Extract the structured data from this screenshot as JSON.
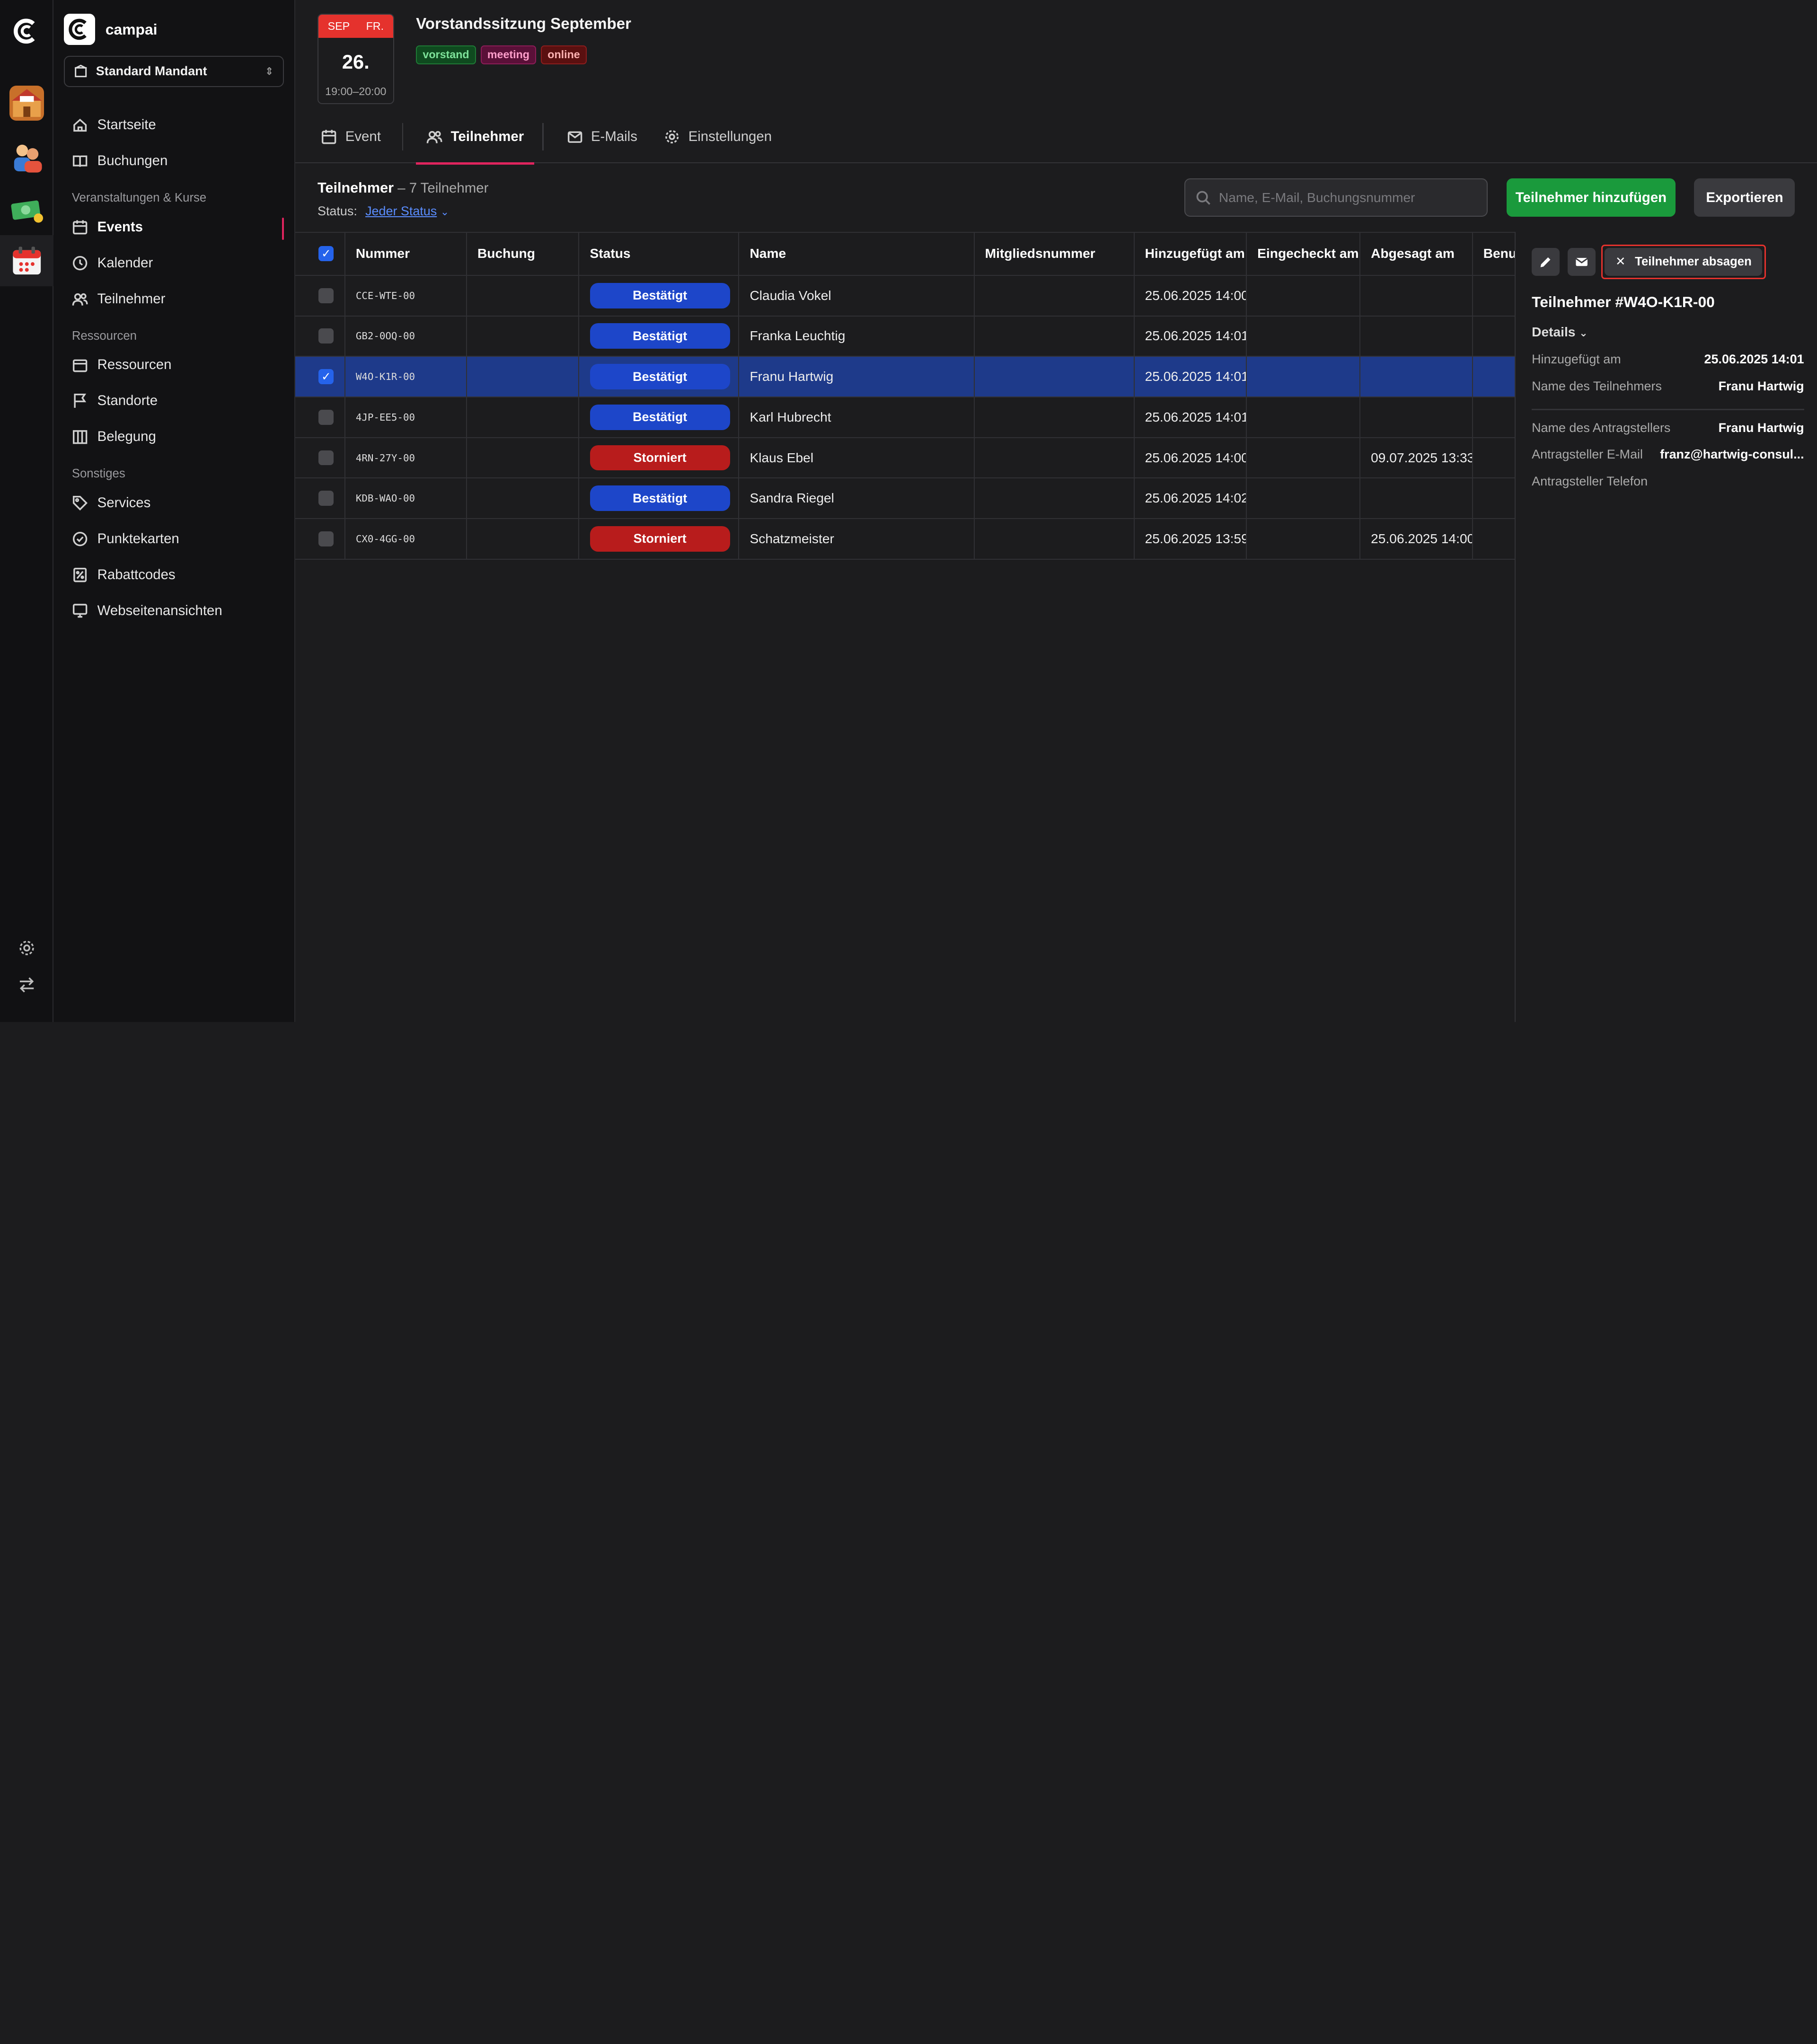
{
  "app": {
    "brand_name": "campai"
  },
  "tenant": {
    "label": "Standard Mandant"
  },
  "sidebar": {
    "items": [
      {
        "label": "Startseite",
        "icon": "home-icon"
      },
      {
        "label": "Buchungen",
        "icon": "book-icon"
      }
    ],
    "sections": [
      {
        "title": "Veranstaltungen & Kurse",
        "items": [
          {
            "label": "Events",
            "icon": "calendar-icon",
            "active": true
          },
          {
            "label": "Kalender",
            "icon": "clock-icon"
          },
          {
            "label": "Teilnehmer",
            "icon": "users-icon"
          }
        ]
      },
      {
        "title": "Ressourcen",
        "items": [
          {
            "label": "Ressourcen",
            "icon": "box-icon"
          },
          {
            "label": "Standorte",
            "icon": "flag-icon"
          },
          {
            "label": "Belegung",
            "icon": "columns-icon"
          }
        ]
      },
      {
        "title": "Sonstiges",
        "items": [
          {
            "label": "Services",
            "icon": "tag-icon"
          },
          {
            "label": "Punktekarten",
            "icon": "check-circle-icon"
          },
          {
            "label": "Rabattcodes",
            "icon": "percent-icon"
          },
          {
            "label": "Webseitenansichten",
            "icon": "monitor-icon"
          }
        ]
      }
    ]
  },
  "event": {
    "month": "SEP",
    "weekday": "FR.",
    "day": "26.",
    "time": "19:00–20:00",
    "title": "Vorstandssitzung September",
    "tags": [
      "vorstand",
      "meeting",
      "online"
    ]
  },
  "tabs": [
    {
      "label": "Event",
      "icon": "calendar-icon"
    },
    {
      "label": "Teilnehmer",
      "icon": "users-icon",
      "active": true
    },
    {
      "label": "E-Mails",
      "icon": "mail-icon"
    },
    {
      "label": "Einstellungen",
      "icon": "gear-icon"
    }
  ],
  "list": {
    "title": "Teilnehmer",
    "count": "– 7 Teilnehmer",
    "status_label": "Status:",
    "status_value": "Jeder Status",
    "search_placeholder": "Name, E-Mail, Buchungsnummer",
    "add_button": "Teilnehmer hinzufügen",
    "export_button": "Exportieren"
  },
  "table": {
    "columns": [
      "Nummer",
      "Buchung",
      "Status",
      "Name",
      "Mitgliedsnummer",
      "Hinzugefügt am",
      "Eingecheckt am",
      "Abgesagt am",
      "Benu"
    ],
    "rows": [
      {
        "number": "CCE-WTE-00",
        "booking": "",
        "status": "Bestätigt",
        "status_type": "confirmed",
        "name": "Claudia Vokel",
        "member_no": "",
        "added": "25.06.2025 14:00",
        "checked_in": "",
        "cancelled": "",
        "selected": false
      },
      {
        "number": "GB2-0OQ-00",
        "booking": "",
        "status": "Bestätigt",
        "status_type": "confirmed",
        "name": "Franka Leuchtig",
        "member_no": "",
        "added": "25.06.2025 14:01",
        "checked_in": "",
        "cancelled": "",
        "selected": false
      },
      {
        "number": "W4O-K1R-00",
        "booking": "",
        "status": "Bestätigt",
        "status_type": "confirmed",
        "name": "Franu Hartwig",
        "member_no": "",
        "added": "25.06.2025 14:01",
        "checked_in": "",
        "cancelled": "",
        "selected": true
      },
      {
        "number": "4JP-EE5-00",
        "booking": "",
        "status": "Bestätigt",
        "status_type": "confirmed",
        "name": "Karl Hubrecht",
        "member_no": "",
        "added": "25.06.2025 14:01",
        "checked_in": "",
        "cancelled": "",
        "selected": false
      },
      {
        "number": "4RN-27Y-00",
        "booking": "",
        "status": "Storniert",
        "status_type": "cancelled",
        "name": "Klaus Ebel",
        "member_no": "",
        "added": "25.06.2025 14:00",
        "checked_in": "",
        "cancelled": "09.07.2025 13:33",
        "selected": false
      },
      {
        "number": "KDB-WAO-00",
        "booking": "",
        "status": "Bestätigt",
        "status_type": "confirmed",
        "name": "Sandra Riegel",
        "member_no": "",
        "added": "25.06.2025 14:02",
        "checked_in": "",
        "cancelled": "",
        "selected": false
      },
      {
        "number": "CX0-4GG-00",
        "booking": "",
        "status": "Storniert",
        "status_type": "cancelled",
        "name": "Schatzmeister",
        "member_no": "",
        "added": "25.06.2025 13:59",
        "checked_in": "",
        "cancelled": "25.06.2025 14:00",
        "selected": false
      }
    ]
  },
  "panel": {
    "cancel_button": "Teilnehmer absagen",
    "title": "Teilnehmer #W4O-K1R-00",
    "details_label": "Details",
    "fields": [
      {
        "key": "Hinzugefügt am",
        "value": "25.06.2025 14:01"
      },
      {
        "key": "Name des Teilnehmers",
        "value": "Franu Hartwig"
      },
      {
        "key": "Name des Antragstellers",
        "value": "Franu Hartwig"
      },
      {
        "key": "Antragsteller E-Mail",
        "value": "franz@hartwig-consul..."
      },
      {
        "key": "Antragsteller Telefon",
        "value": ""
      }
    ]
  },
  "colors": {
    "accent": "#e0245e",
    "confirmed": "#1d46c9",
    "cancelled": "#b81c1c",
    "primary_button": "#1a9a3c",
    "selected_row": "#1e3a8a"
  }
}
